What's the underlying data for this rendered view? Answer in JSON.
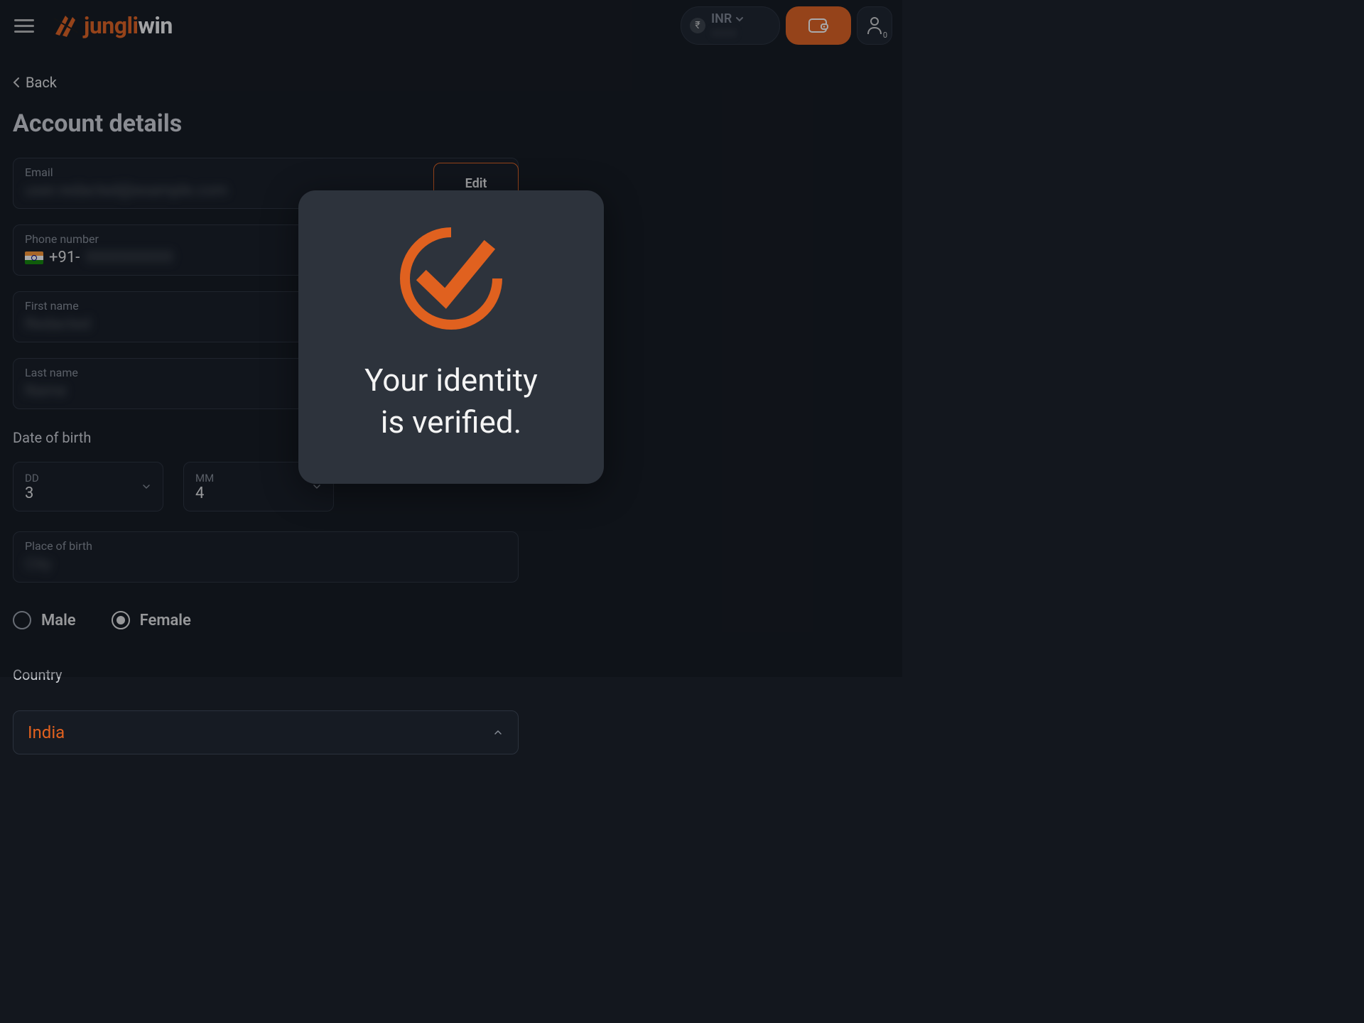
{
  "header": {
    "logo_jungli": "jungli",
    "logo_win": "win",
    "currency_code": "INR",
    "currency_amount": "0000",
    "account_badge": "0"
  },
  "nav": {
    "back_label": "Back"
  },
  "page": {
    "title": "Account details"
  },
  "form": {
    "email_label": "Email",
    "email_value": "user.redacted@example.com",
    "edit_label": "Edit",
    "phone_label": "Phone number",
    "phone_prefix": "+91-",
    "phone_value": "0000000000",
    "first_name_label": "First name",
    "first_name_value": "Redacted",
    "last_name_label": "Last name",
    "last_name_value": "Name",
    "dob_section": "Date of birth",
    "dob_dd_label": "DD",
    "dob_dd_value": "3",
    "dob_mm_label": "MM",
    "dob_mm_value": "4",
    "place_label": "Place of birth",
    "place_value": "City",
    "gender_male": "Male",
    "gender_female": "Female",
    "gender_selected": "Female",
    "country_section": "Country",
    "country_value": "India"
  },
  "modal": {
    "line1": "Your identity",
    "line2": "is verified."
  },
  "colors": {
    "accent": "#e0611f",
    "bg": "#13171e",
    "card": "#2d333c"
  }
}
